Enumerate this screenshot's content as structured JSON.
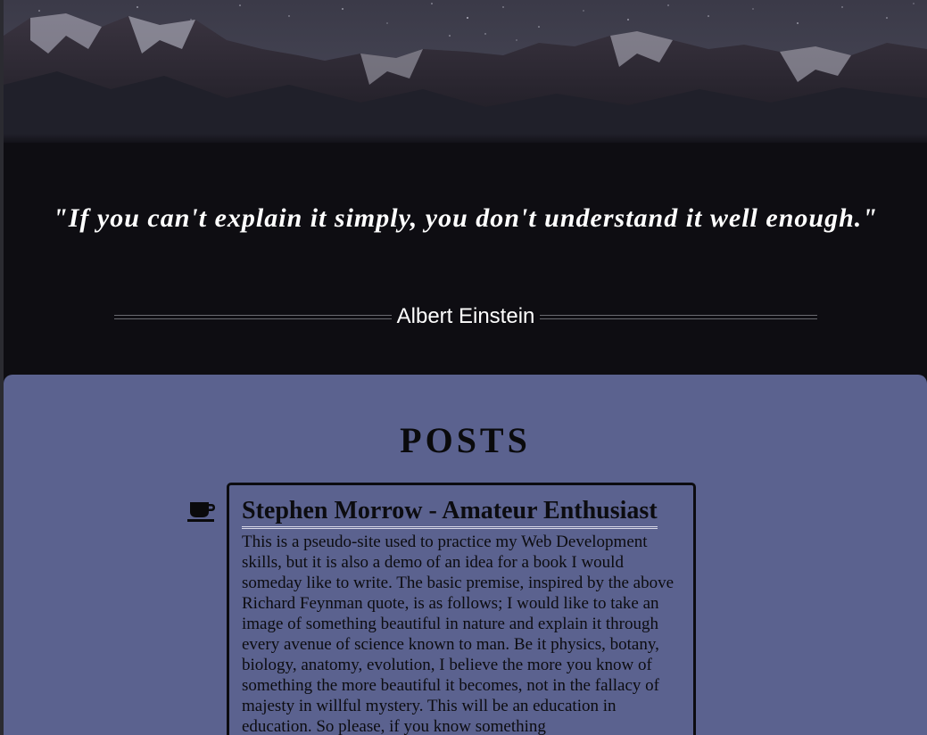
{
  "quote": {
    "text": "\"If you can't explain it simply, you don't understand it well enough.\"",
    "author": "Albert Einstein"
  },
  "posts": {
    "heading": "POSTS",
    "icon": "coffee-cup-icon",
    "items": [
      {
        "title": "Stephen Morrow - Amateur Enthusiast",
        "body": "This is a pseudo-site used to practice my Web Development skills, but it is also a demo of an idea for a book I would someday like to write. The basic premise, inspired by the above Richard Feynman quote, is as follows; I would like to take an image of something beautiful in nature and explain it through every avenue of science known to man. Be it physics, botany, biology, anatomy, evolution, I believe the more you know of something the more beautiful it becomes, not in the fallacy of majesty in willful mystery. This will be an education in education. So please, if you know something"
      }
    ]
  },
  "colors": {
    "background": "#0e0d12",
    "posts_background": "#5b628f",
    "text_light": "#ffffff",
    "text_dark": "#0c0c10"
  }
}
